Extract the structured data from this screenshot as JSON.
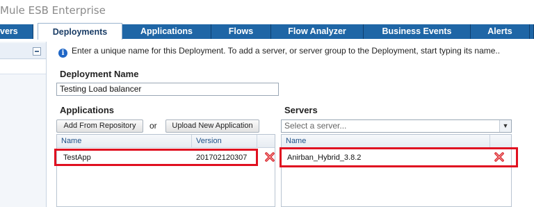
{
  "app": {
    "title": "Mule ESB Enterprise"
  },
  "tabs": [
    {
      "label": "vers",
      "active": false
    },
    {
      "label": "Deployments",
      "active": true
    },
    {
      "label": "Applications",
      "active": false
    },
    {
      "label": "Flows",
      "active": false
    },
    {
      "label": "Flow Analyzer",
      "active": false
    },
    {
      "label": "Business Events",
      "active": false
    },
    {
      "label": "Alerts",
      "active": false
    }
  ],
  "info": {
    "text": "Enter a unique name for this Deployment. To add a server, or server group to the Deployment, start typing its name.."
  },
  "deployment": {
    "name_label": "Deployment Name",
    "name_value": "Testing Load balancer"
  },
  "applications": {
    "section_label": "Applications",
    "add_button": "Add From Repository",
    "or_text": "or",
    "upload_button": "Upload New Application",
    "columns": {
      "name": "Name",
      "version": "Version"
    },
    "rows": [
      {
        "name": "TestApp",
        "version": "201702120307"
      }
    ]
  },
  "servers": {
    "section_label": "Servers",
    "select_placeholder": "Select a server...",
    "columns": {
      "name": "Name"
    },
    "rows": [
      {
        "name": "Anirban_Hybrid_3.8.2"
      }
    ]
  },
  "colors": {
    "tab_bg": "#1f66a6",
    "highlight": "#e01020",
    "delete": "#d9262c"
  }
}
